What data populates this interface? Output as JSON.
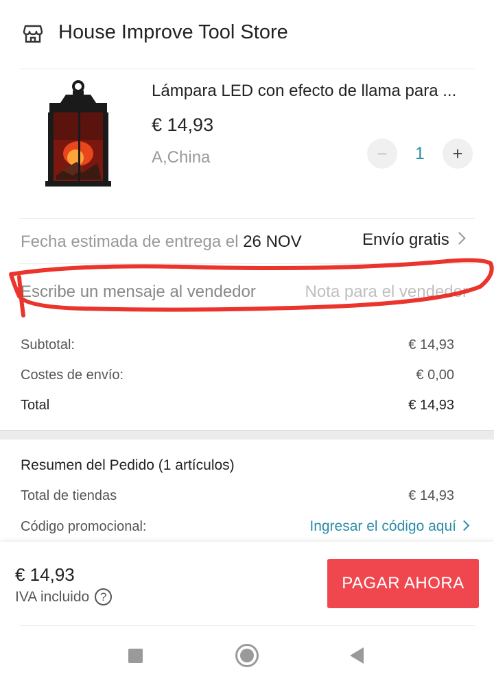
{
  "store": {
    "name": "House Improve Tool Store",
    "icon": "store-icon"
  },
  "product": {
    "title": "Lámpara LED con efecto de llama para ...",
    "price": "€ 14,93",
    "variant": "A,China",
    "quantity": "1",
    "image": "led-flame-lantern"
  },
  "delivery": {
    "label": "Fecha estimada de entrega el",
    "date": "26 NOV",
    "shipping": "Envío gratis"
  },
  "message": {
    "label": "Escribe un mensaje al vendedor",
    "placeholder": "Nota para el vendedor",
    "value": ""
  },
  "annotation": {
    "color": "#e8231a"
  },
  "totals": {
    "subtotal_label": "Subtotal:",
    "subtotal_value": "€ 14,93",
    "shipping_label": "Costes de envío:",
    "shipping_value": "€ 0,00",
    "total_label": "Total",
    "total_value": "€ 14,93"
  },
  "summary": {
    "title": "Resumen del Pedido (1 artículos)",
    "stores_total_label": "Total de tiendas",
    "stores_total_value": "€ 14,93",
    "promo_label": "Código promocional:",
    "promo_link": "Ingresar el código aquí"
  },
  "checkout": {
    "price": "€ 14,93",
    "vat_label": "IVA incluido",
    "pay_button": "PAGAR AHORA",
    "accent": "#f0474f"
  }
}
